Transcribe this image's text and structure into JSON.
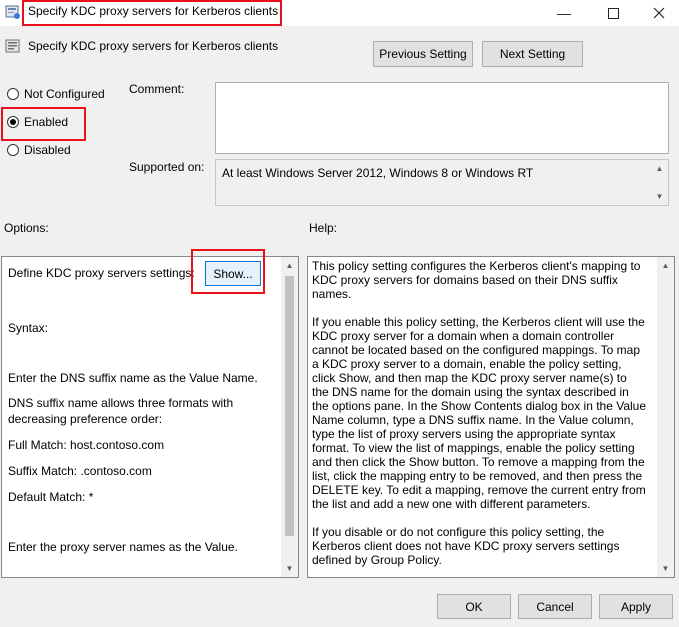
{
  "window": {
    "title": "Specify KDC proxy servers for Kerberos clients",
    "minimize_icon": "minimize-icon",
    "maximize_icon": "maximize-icon",
    "close_icon": "close-icon"
  },
  "header": {
    "title": "Specify KDC proxy servers for Kerberos clients",
    "previous_label": "Previous Setting",
    "next_label": "Next Setting"
  },
  "state": {
    "options": [
      {
        "label": "Not Configured",
        "selected": false
      },
      {
        "label": "Enabled",
        "selected": true
      },
      {
        "label": "Disabled",
        "selected": false
      }
    ]
  },
  "comment": {
    "label": "Comment:",
    "value": ""
  },
  "supported": {
    "label": "Supported on:",
    "value": "At least Windows Server 2012, Windows 8 or Windows RT"
  },
  "options_pane": {
    "label": "Options:",
    "define_label": "Define KDC proxy servers settings:",
    "show_label": "Show...",
    "lines": [
      "Syntax:",
      "Enter the DNS suffix name as the Value Name.",
      "DNS suffix name allows three formats with",
      "decreasing preference order:",
      "Full Match: host.contoso.com",
      "Suffix Match: .contoso.com",
      "Default Match: *",
      "Enter the proxy server names as the Value."
    ]
  },
  "help_pane": {
    "label": "Help:",
    "paragraphs": [
      "This policy setting configures the Kerberos client's mapping to KDC proxy servers for domains based on their DNS suffix names.",
      "If you enable this policy setting, the Kerberos client will use the KDC proxy server for a domain when a domain controller cannot be located based on the configured mappings. To map a KDC proxy server to a domain, enable the policy setting, click Show, and then map the KDC proxy server name(s) to the DNS name for the domain using the syntax described in the options pane. In the Show Contents dialog box in the Value Name column, type a DNS suffix name. In the Value column, type the list of proxy servers using the appropriate syntax format. To view the list of mappings, enable the policy setting and then click the Show button. To remove a mapping from the list, click the mapping entry to be removed, and then press the DELETE key. To edit a mapping, remove the current entry from the list and add a new one with different parameters.",
      "If you disable or do not configure this policy setting, the Kerberos client does not have KDC proxy servers settings defined by Group Policy."
    ]
  },
  "footer": {
    "ok_label": "OK",
    "cancel_label": "Cancel",
    "apply_label": "Apply"
  },
  "colors": {
    "highlight": "#e8111b",
    "dialog_bg": "#f0f0f0",
    "button_bg": "#e1e1e1"
  }
}
